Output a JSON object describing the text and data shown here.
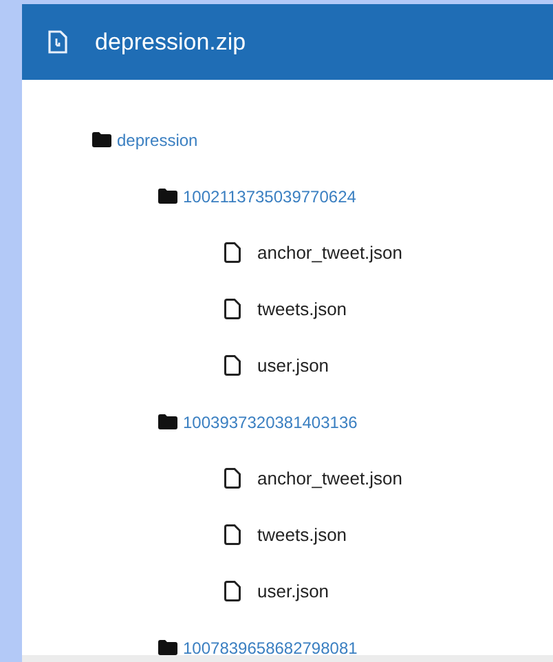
{
  "header": {
    "title": "depression.zip"
  },
  "tree": [
    {
      "kind": "folder",
      "name": "depression",
      "children": [
        {
          "kind": "folder",
          "name": "1002113735039770624",
          "children": [
            {
              "kind": "file",
              "name": "anchor_tweet.json"
            },
            {
              "kind": "file",
              "name": "tweets.json"
            },
            {
              "kind": "file",
              "name": "user.json"
            }
          ]
        },
        {
          "kind": "folder",
          "name": "1003937320381403136",
          "children": [
            {
              "kind": "file",
              "name": "anchor_tweet.json"
            },
            {
              "kind": "file",
              "name": "tweets.json"
            },
            {
              "kind": "file",
              "name": "user.json"
            }
          ]
        },
        {
          "kind": "folder",
          "name": "1007839658682798081"
        }
      ]
    }
  ]
}
